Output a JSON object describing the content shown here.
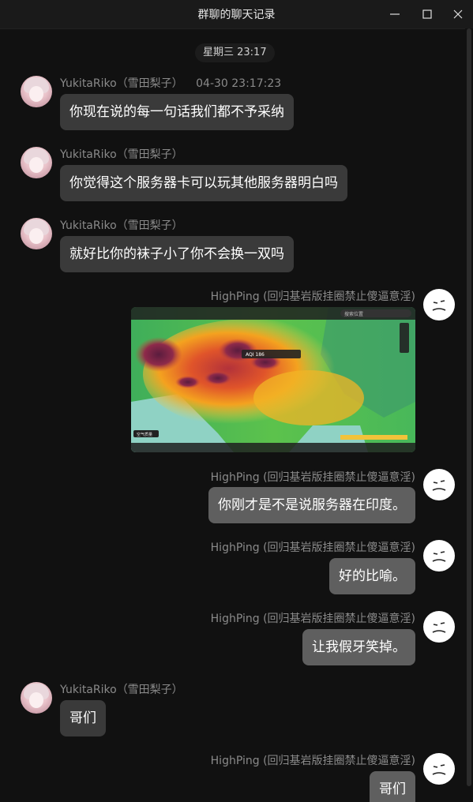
{
  "window": {
    "title": "群聊的聊天记录",
    "minimize_icon": "minimize-icon",
    "maximize_icon": "maximize-icon",
    "close_icon": "close-icon"
  },
  "time_divider": "星期三 23:17",
  "messages": [
    {
      "sender": "YukitaRiko（雪田梨子）",
      "timestamp": "04-30 23:17:23",
      "text": "你现在说的每一句话我们都不予采纳",
      "side": "left"
    },
    {
      "sender": "YukitaRiko（雪田梨子）",
      "text": "你觉得这个服务器卡可以玩其他服务器明白吗",
      "side": "left"
    },
    {
      "sender": "YukitaRiko（雪田梨子）",
      "text": "就好比你的袜子小了你不会换一双吗",
      "side": "left"
    },
    {
      "sender": "HighPing (回归基岩版挂圈禁止傻逼意淫)",
      "type": "image",
      "image_desc": "air-quality-map-screenshot",
      "side": "right"
    },
    {
      "sender": "HighPing (回归基岩版挂圈禁止傻逼意淫)",
      "text": "你刚才是不是说服务器在印度。",
      "side": "right"
    },
    {
      "sender": "HighPing (回归基岩版挂圈禁止傻逼意淫)",
      "text": "好的比喻。",
      "side": "right"
    },
    {
      "sender": "HighPing (回归基岩版挂圈禁止傻逼意淫)",
      "text": "让我假牙笑掉。",
      "side": "right"
    },
    {
      "sender": "YukitaRiko（雪田梨子）",
      "text": "哥们",
      "side": "left"
    },
    {
      "sender": "HighPing (回归基岩版挂圈禁止傻逼意淫)",
      "text": "哥们",
      "side": "right"
    }
  ],
  "map_image": {
    "search_placeholder": "搜索位置",
    "aqi_label": "AQI 186",
    "bottom_legend": "空气质量"
  },
  "colors": {
    "background": "#111111",
    "bubble_left": "#3a3a3a",
    "bubble_right": "#5f5f5f",
    "sender_text": "#8a8a8a"
  }
}
